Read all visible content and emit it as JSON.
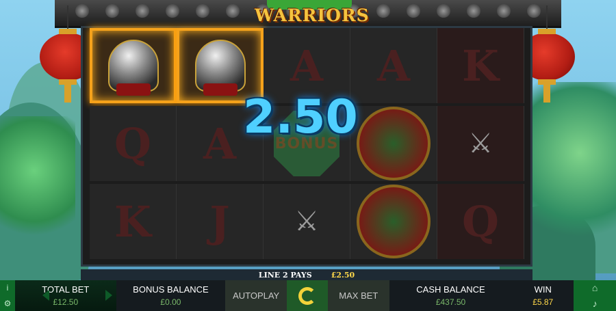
{
  "logo": {
    "title": "WARRIORS"
  },
  "reels": {
    "rows": [
      [
        {
          "symbol": "helmet",
          "win": true
        },
        {
          "symbol": "helmet",
          "win": true
        },
        {
          "symbol": "A"
        },
        {
          "symbol": "A"
        },
        {
          "symbol": "K"
        }
      ],
      [
        {
          "symbol": "Q"
        },
        {
          "symbol": "A"
        },
        {
          "symbol": "bonus",
          "label": "BONUS"
        },
        {
          "symbol": "bamboo"
        },
        {
          "symbol": "sword"
        }
      ],
      [
        {
          "symbol": "K"
        },
        {
          "symbol": "J"
        },
        {
          "symbol": "sword"
        },
        {
          "symbol": "bamboo"
        },
        {
          "symbol": "Q"
        }
      ]
    ]
  },
  "win_display": {
    "amount": "2.50"
  },
  "line_pays": {
    "label": "LINE 2 PAYS",
    "amount": "£2.50"
  },
  "bottom_bar": {
    "total_bet": {
      "label": "TOTAL BET",
      "value": "£12.50"
    },
    "bonus_balance": {
      "label": "BONUS BALANCE",
      "value": "£0.00"
    },
    "autoplay_label": "AUTOPLAY",
    "max_bet_label": "MAX BET",
    "cash_balance": {
      "label": "CASH BALANCE",
      "value": "£437.50"
    },
    "win": {
      "label": "WIN",
      "value": "£5.87"
    }
  },
  "icons": {
    "info": "info-icon",
    "settings": "gear-icon",
    "home": "home-icon",
    "sound": "speaker-icon",
    "spin": "spin-icon"
  }
}
